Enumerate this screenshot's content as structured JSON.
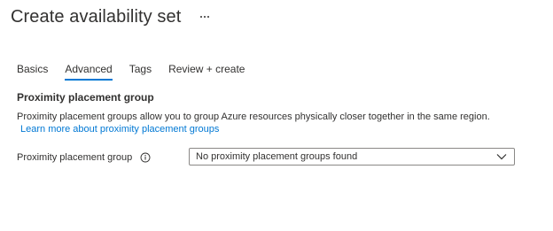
{
  "header": {
    "title": "Create availability set",
    "more_label": "···"
  },
  "tabs": [
    {
      "label": "Basics",
      "active": false
    },
    {
      "label": "Advanced",
      "active": true
    },
    {
      "label": "Tags",
      "active": false
    },
    {
      "label": "Review + create",
      "active": false
    }
  ],
  "section": {
    "heading": "Proximity placement group",
    "description": "Proximity placement groups allow you to group Azure resources physically closer together in the same region.",
    "learn_more": "Learn more about proximity placement groups"
  },
  "field": {
    "label": "Proximity placement group",
    "value": "No proximity placement groups found",
    "info_icon": "info-icon",
    "dropdown_icon": "chevron-down-icon"
  },
  "colors": {
    "accent": "#0078d4",
    "text": "#323130",
    "border": "#8a8886"
  }
}
